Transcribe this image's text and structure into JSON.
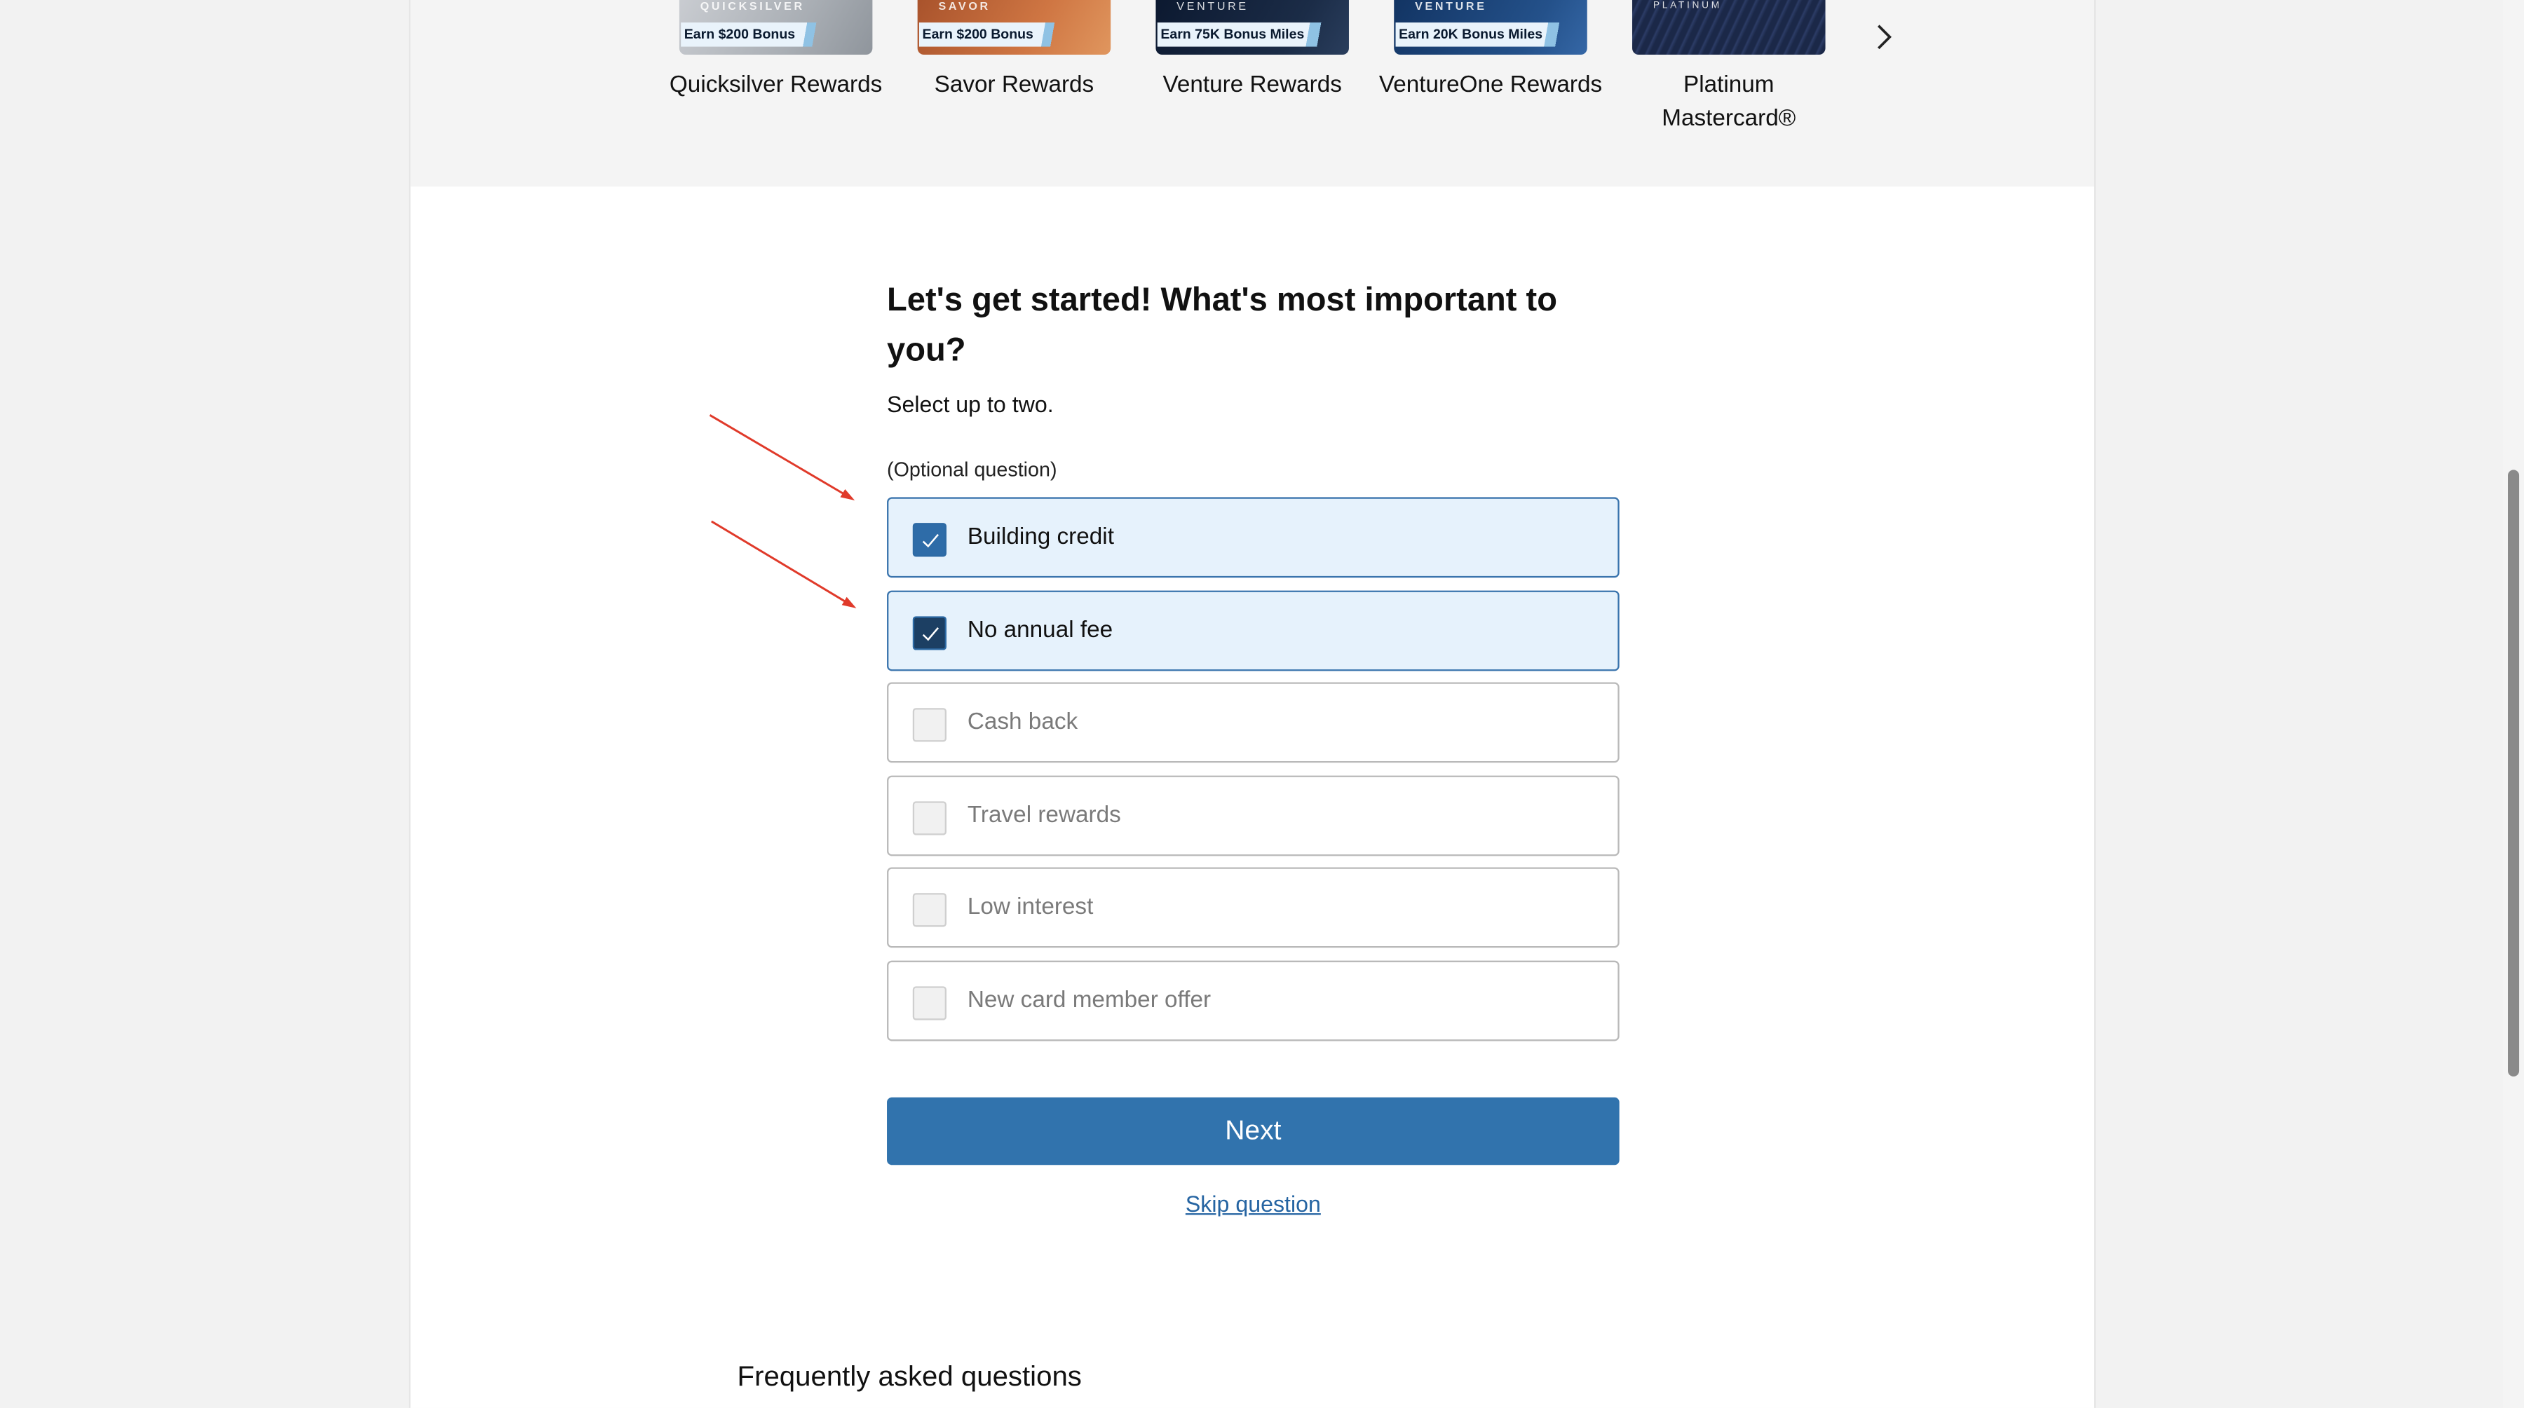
{
  "carousel": {
    "cards": [
      {
        "brand": "QUICKSILVER",
        "badge": "Earn $200 Bonus",
        "name": "Quicksilver Rewards",
        "colors": [
          "#c2c6cb",
          "#9aa1a8"
        ]
      },
      {
        "brand": "SAVOR",
        "badge": "Earn $200 Bonus",
        "name": "Savor Rewards",
        "colors": [
          "#b8643a",
          "#d9824f"
        ]
      },
      {
        "brand": "VENTURE",
        "badge": "Earn 75K Bonus Miles",
        "name": "Venture Rewards",
        "colors": [
          "#0f1d33",
          "#22344f"
        ]
      },
      {
        "brand": "VENTURE",
        "badge": "Earn 20K Bonus Miles",
        "name": "VentureOne Rewards",
        "colors": [
          "#173b6a",
          "#2b5990"
        ]
      },
      {
        "brand": "PLATINUM",
        "badge": "",
        "name": "Platinum Mastercard®",
        "colors": [
          "#1e2c4f",
          "#3a4c78"
        ]
      }
    ],
    "next_icon": "chevron-right-icon"
  },
  "question": {
    "heading": "Let's get started! What's most important to you?",
    "subtext": "Select up to two.",
    "optional_label": "(Optional question)"
  },
  "options": [
    {
      "label": "Building credit",
      "checked": true
    },
    {
      "label": "No annual fee",
      "checked": true
    },
    {
      "label": "Cash back",
      "checked": false
    },
    {
      "label": "Travel rewards",
      "checked": false
    },
    {
      "label": "Low interest",
      "checked": false
    },
    {
      "label": "New card member offer",
      "checked": false
    }
  ],
  "actions": {
    "next_label": "Next",
    "skip_label": "Skip question"
  },
  "faq": {
    "title": "Frequently asked questions"
  },
  "colors": {
    "accent": "#3173ad",
    "selected_bg": "#e6f2fc",
    "annotation_arrow": "#e03a2a"
  }
}
